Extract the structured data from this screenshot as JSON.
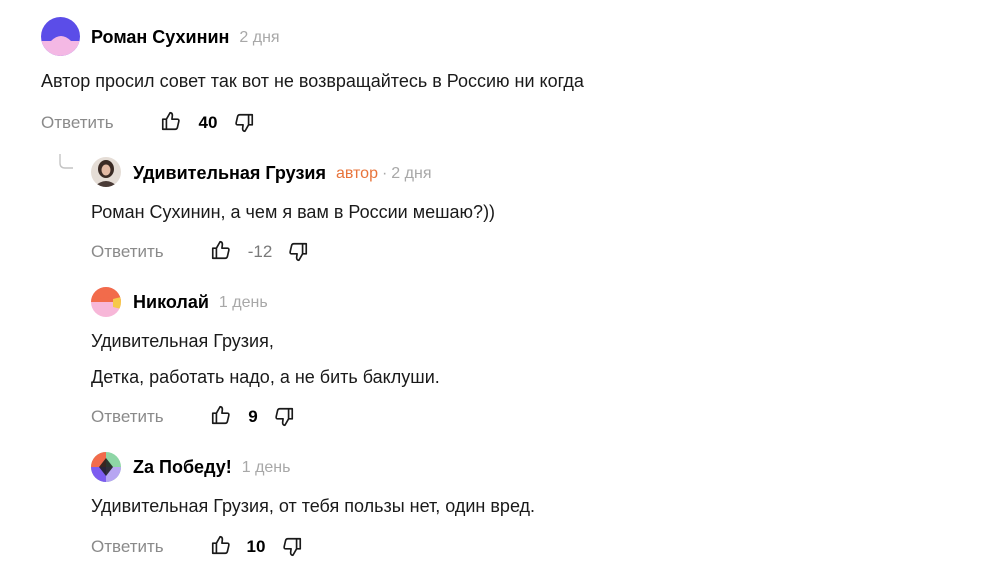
{
  "comments": [
    {
      "author": "Роман Сухинин",
      "time": "2 дня",
      "lines": [
        "Автор просил совет так вот не возвращайтесь в Россию ни когда"
      ],
      "reply_label": "Ответить",
      "score": "40"
    },
    {
      "author": "Удивительная Грузия",
      "badge": "автор",
      "separator": "·",
      "time": "2 дня",
      "lines": [
        "Роман Сухинин, а чем я вам в России мешаю?))"
      ],
      "reply_label": "Ответить",
      "score": "-12"
    },
    {
      "author": "Николай",
      "time": "1 день",
      "lines": [
        "Удивительная Грузия,",
        "Детка, работать надо, а не бить баклуши."
      ],
      "reply_label": "Ответить",
      "score": "9"
    },
    {
      "author": "Za Победу!",
      "time": "1 день",
      "lines": [
        "Удивительная Грузия, от тебя пользы нет, один вред."
      ],
      "reply_label": "Ответить",
      "score": "10"
    }
  ],
  "colors": {
    "author_badge": "#e8743b",
    "muted": "#a8a8a8",
    "action": "#8a8a8a"
  },
  "icons": {
    "like": "thumbs-up-icon",
    "dislike": "thumbs-down-icon",
    "thread": "thread-branch-icon"
  }
}
